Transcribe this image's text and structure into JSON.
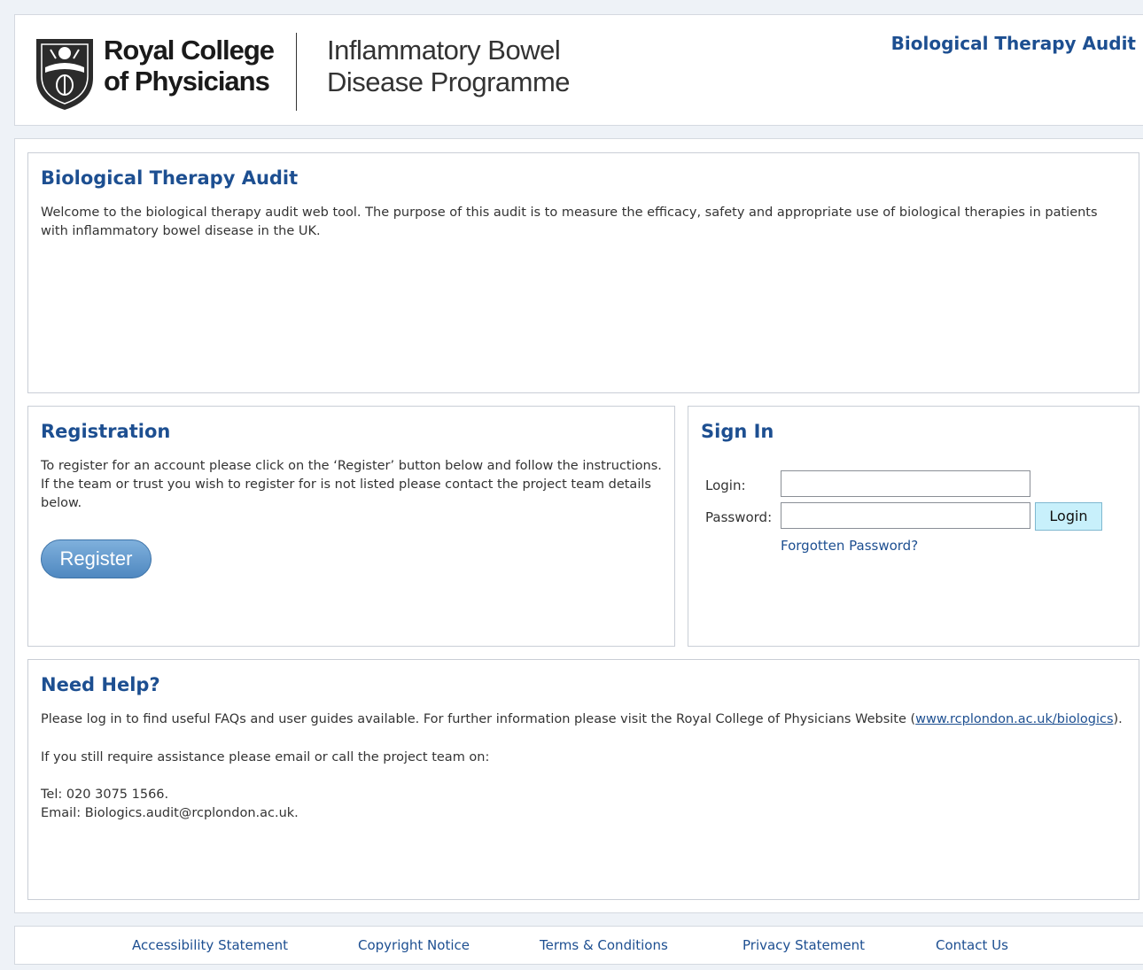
{
  "header": {
    "logo": {
      "line1": "Royal College",
      "line2": "of Physicians"
    },
    "programme": {
      "line1": "Inflammatory Bowel",
      "line2": "Disease Programme"
    },
    "title": "Biological Therapy Audit"
  },
  "welcome": {
    "title": "Biological Therapy Audit",
    "text": "Welcome to the biological therapy audit web tool. The purpose of this audit is to measure the efficacy, safety and appropriate use of biological therapies in patients with inflammatory bowel disease in the UK."
  },
  "registration": {
    "title": "Registration",
    "text": "To register for an account please click on the ‘Register’ button below and follow the instructions. If the team or trust you wish to register for is not listed please contact the project team details below.",
    "button": "Register"
  },
  "signin": {
    "title": "Sign In",
    "login_label": "Login:",
    "login_value": "",
    "password_label": "Password:",
    "password_value": "",
    "login_button": "Login",
    "forgot": "Forgotten Password?"
  },
  "help": {
    "title": "Need Help?",
    "text1_before": "Please log in to find useful FAQs and user guides available. For further information please visit the Royal College of Physicians Website (",
    "text1_link": "www.rcplondon.ac.uk/biologics",
    "text1_after": ").",
    "text2": "If you still require assistance please email or call the project team on:",
    "tel": "Tel: 020 3075 1566.",
    "email": "Email: Biologics.audit@rcplondon.ac.uk."
  },
  "footer": {
    "links": [
      "Accessibility Statement",
      "Copyright Notice",
      "Terms & Conditions",
      "Privacy Statement",
      "Contact Us"
    ]
  },
  "colors": {
    "accent": "#1d4f91",
    "page_background": "#eef2f7",
    "register_button": "#5b93c8",
    "login_button": "#c8f0fb"
  }
}
